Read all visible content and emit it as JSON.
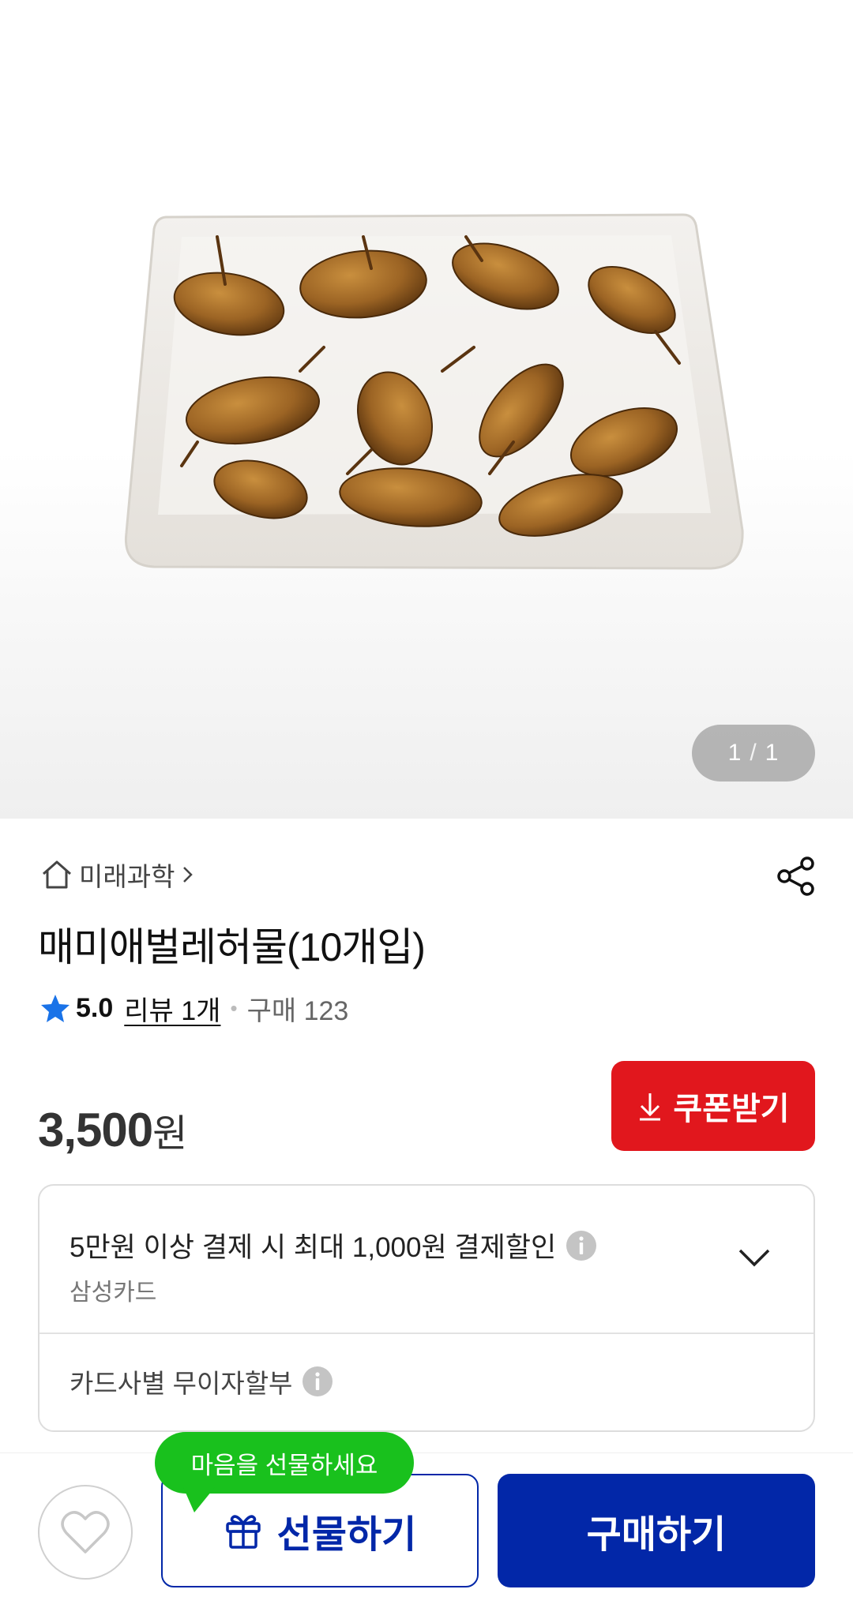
{
  "gallery": {
    "current": "1",
    "separator": "/",
    "total": "1"
  },
  "store": {
    "name": "미래과학"
  },
  "product": {
    "title": "매미애벌레허물(10개입)",
    "rating": "5.0",
    "review_label": "리뷰 1개",
    "purchase_label": "구매 123",
    "price_amount": "3,500",
    "price_unit": "원"
  },
  "coupon": {
    "label": "쿠폰받기"
  },
  "benefits": {
    "card_discount": "5만원 이상 결제 시 최대 1,000원 결제할인",
    "card_name": "삼성카드",
    "installment": "카드사별 무이자할부"
  },
  "bottom_bar": {
    "gift_tooltip": "마음을 선물하세요",
    "gift_label": "선물하기",
    "buy_label": "구매하기"
  },
  "colors": {
    "primary_blue": "#0227a8",
    "coupon_red": "#e1171d",
    "tooltip_green": "#19c11d",
    "star_blue": "#1a73e8"
  },
  "icons": [
    "home-icon",
    "chevron-right-icon",
    "share-icon",
    "star-icon",
    "download-icon",
    "info-icon",
    "chevron-down-icon",
    "heart-icon",
    "gift-icon"
  ]
}
